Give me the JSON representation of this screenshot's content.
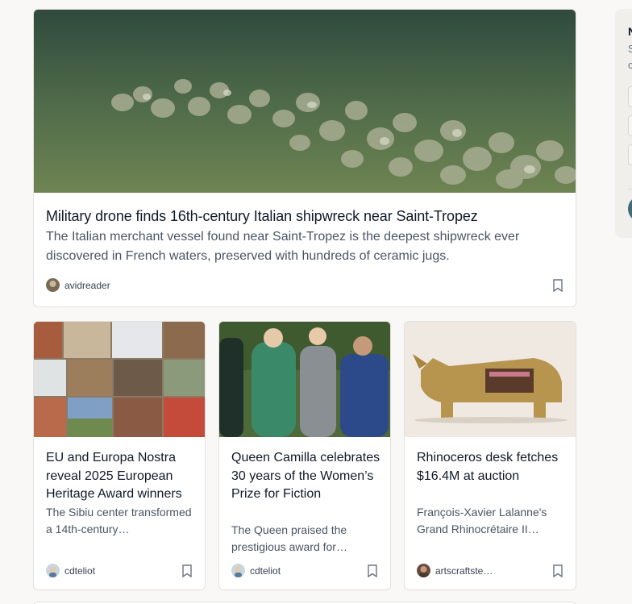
{
  "hero": {
    "title": "Military drone finds 16th-century Italian shipwreck near Saint-Tropez",
    "description": "The Italian merchant vessel found near Saint-Tropez is the deepest shipwreck ever discovered in French waters, preserved with hundreds of ceramic jugs.",
    "author": "avidreader",
    "image_icon": "shipwreck-photo"
  },
  "cards": [
    {
      "title": "EU and Europa Nostra reveal 2025 European Heritage Award winners",
      "description": "The Sibiu center transformed a 14th-century…",
      "author": "cdteliot",
      "image_icon": "heritage-collage-photo"
    },
    {
      "title": "Queen Camilla celebrates 30 years of the Women’s Prize for Fiction",
      "description": "The Queen praised the prestigious award for…",
      "author": "cdteliot",
      "image_icon": "queen-camilla-photo"
    },
    {
      "title": "Rhinoceros desk fetches $16.4M at auction",
      "description": "François-Xavier Lalanne's Grand Rhinocrétaire II…",
      "author": "artscraftste…",
      "image_icon": "rhinoceros-desk-photo"
    }
  ],
  "side_panel": {
    "title": "N",
    "line1": "S",
    "line2": "c"
  },
  "colors": {
    "background": "#f9f8f6",
    "card": "#ffffff",
    "border": "#e3e1dc",
    "title": "#111827",
    "body": "#4b5563",
    "accent": "#3f6b7a"
  }
}
